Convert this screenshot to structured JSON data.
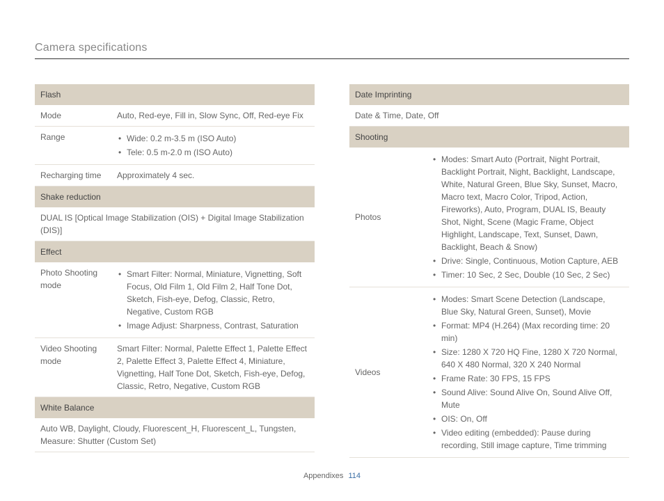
{
  "page_title": "Camera specifications",
  "footer": {
    "section": "Appendixes",
    "page": "114"
  },
  "left": {
    "flash_header": "Flash",
    "flash_mode_label": "Mode",
    "flash_mode_value": "Auto, Red-eye, Fill in, Slow Sync, Off, Red-eye Fix",
    "flash_range_label": "Range",
    "flash_range_wide": "Wide: 0.2 m-3.5 m (ISO Auto)",
    "flash_range_tele": "Tele: 0.5 m-2.0 m (ISO Auto)",
    "flash_recharge_label": "Recharging time",
    "flash_recharge_value": "Approximately 4 sec.",
    "shake_header": "Shake reduction",
    "shake_value": "DUAL IS [Optical Image Stabilization (OIS) + Digital Image Stabilization (DIS)]",
    "effect_header": "Effect",
    "photo_mode_label": "Photo Shooting mode",
    "photo_mode_b1": "Smart Filter: Normal, Miniature, Vignetting, Soft Focus, Old Film 1, Old Film 2, Half Tone Dot, Sketch, Fish-eye, Defog, Classic, Retro, Negative, Custom RGB",
    "photo_mode_b2": "Image Adjust: Sharpness, Contrast, Saturation",
    "video_mode_label": "Video Shooting mode",
    "video_mode_value": "Smart Filter: Normal, Palette Effect 1, Palette Effect 2, Palette Effect 3, Palette Effect 4, Miniature, Vignetting, Half Tone Dot, Sketch, Fish-eye, Defog, Classic, Retro, Negative, Custom RGB",
    "wb_header": "White Balance",
    "wb_value": "Auto WB, Daylight, Cloudy, Fluorescent_H, Fluorescent_L, Tungsten, Measure: Shutter (Custom Set)"
  },
  "right": {
    "date_header": "Date Imprinting",
    "date_value": "Date & Time, Date, Off",
    "shoot_header": "Shooting",
    "photos_label": "Photos",
    "photos_b1": "Modes: Smart Auto (Portrait, Night Portrait, Backlight Portrait, Night, Backlight, Landscape, White, Natural Green, Blue Sky, Sunset, Macro, Macro text, Macro Color, Tripod, Action, Fireworks), Auto, Program, DUAL IS, Beauty Shot, Night, Scene (Magic Frame, Object Highlight, Landscape, Text, Sunset, Dawn, Backlight, Beach & Snow)",
    "photos_b2": "Drive: Single, Continuous, Motion Capture, AEB",
    "photos_b3": "Timer: 10 Sec, 2 Sec, Double (10 Sec, 2 Sec)",
    "videos_label": "Videos",
    "videos_b1": "Modes: Smart Scene Detection (Landscape, Blue Sky, Natural Green, Sunset), Movie",
    "videos_b2": "Format: MP4 (H.264) (Max recording time: 20 min)",
    "videos_b3": "Size: 1280 X 720 HQ Fine, 1280 X 720 Normal, 640 X 480 Normal, 320 X 240 Normal",
    "videos_b4": "Frame Rate: 30 FPS, 15 FPS",
    "videos_b5": "Sound Alive: Sound Alive On, Sound Alive Off, Mute",
    "videos_b6": "OIS: On, Off",
    "videos_b7": "Video editing (embedded): Pause during recording, Still image capture, Time trimming"
  }
}
